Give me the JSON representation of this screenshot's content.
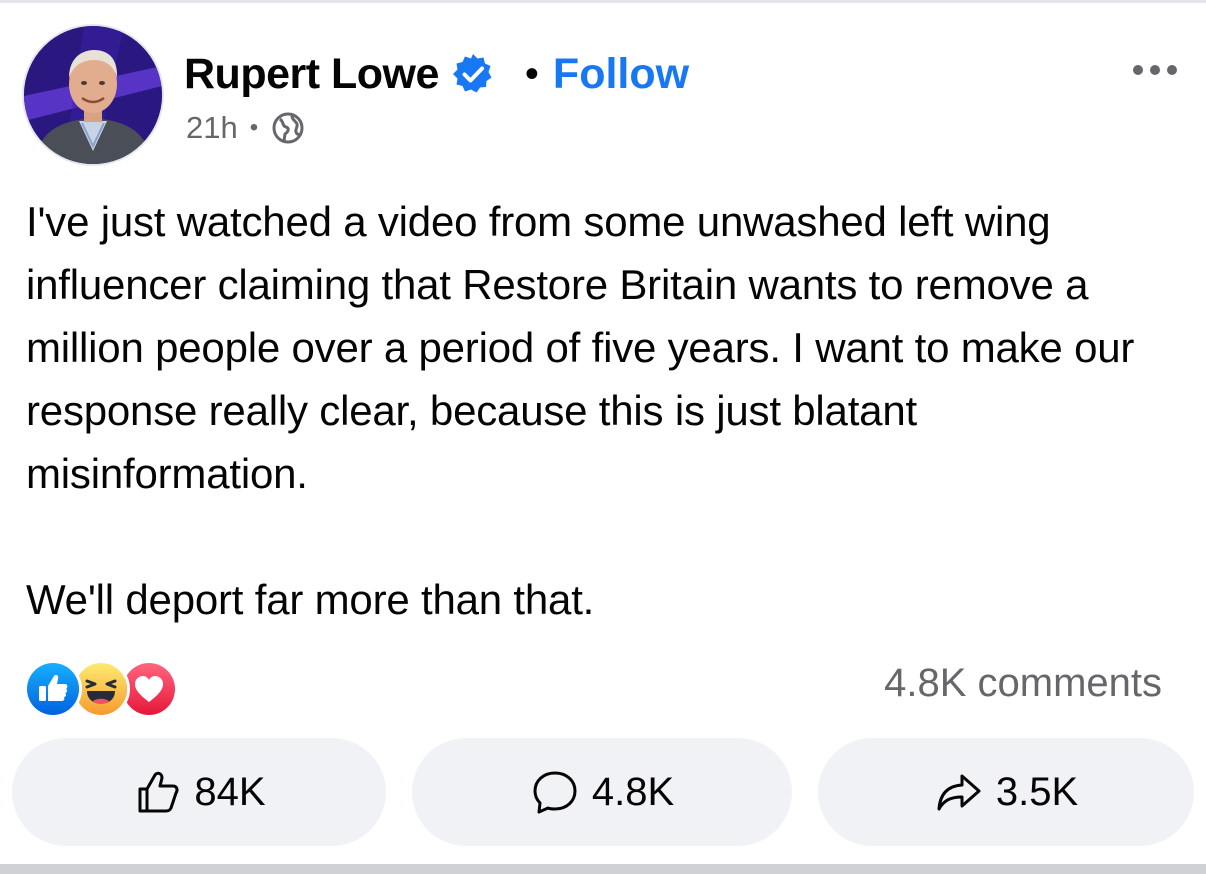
{
  "post": {
    "author": "Rupert Lowe",
    "follow_label": "Follow",
    "timestamp": "21h",
    "paragraphs": [
      "I've just watched a video from some unwashed left wing influencer claiming that Restore Britain wants to remove a million people over a period of five years. I want to make our response really clear, because this is just blatant misinformation.",
      "We'll deport far more than that."
    ]
  },
  "reactions": {
    "types": [
      "like",
      "haha",
      "love"
    ],
    "comments_summary": "4.8K comments"
  },
  "actions": {
    "like_count": "84K",
    "comment_count": "4.8K",
    "share_count": "3.5K"
  },
  "colors": {
    "accent": "#1877f2",
    "text": "#050505",
    "secondary": "#65676b",
    "button_bg": "#f0f2f5"
  }
}
